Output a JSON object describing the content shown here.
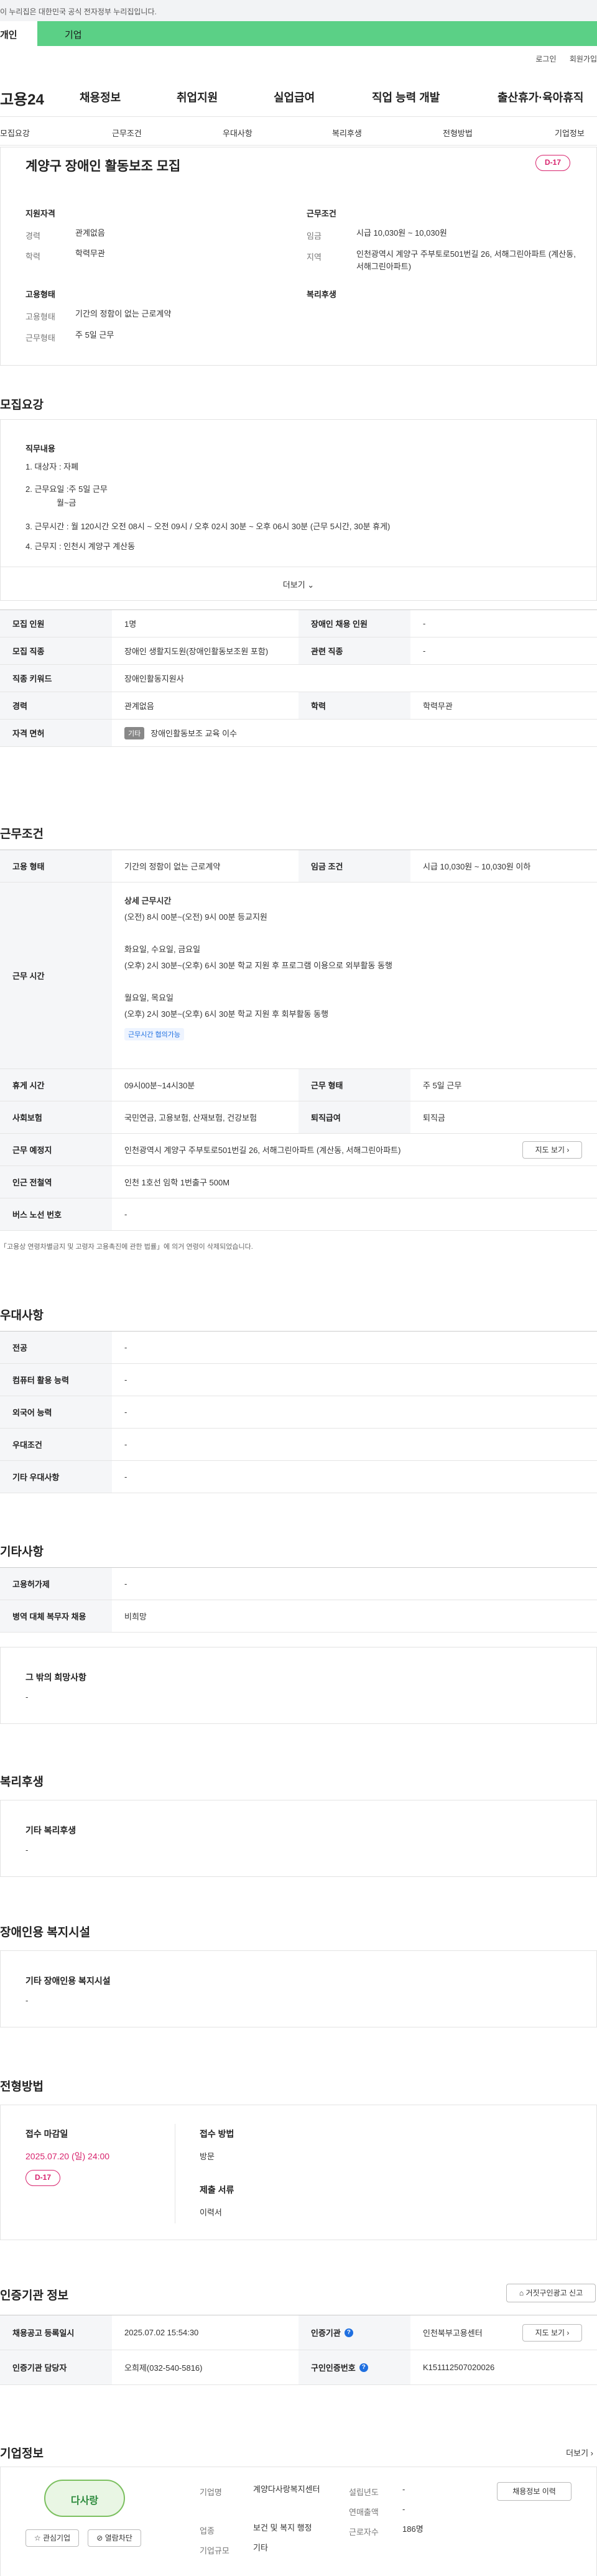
{
  "banner": {
    "text": "이 누리집은 대한민국 공식 전자정부 누리집입니다."
  },
  "tabs": {
    "individual": "개인",
    "business": "기업"
  },
  "top_links": {
    "login": "로그인",
    "signup": "회원가입"
  },
  "gnb": {
    "logo": "고용24",
    "items": [
      "채용정보",
      "취업지원",
      "실업급여",
      "직업 능력 개발",
      "출산휴가·육아휴직"
    ]
  },
  "subnav": [
    "모집요강",
    "근무조건",
    "우대사항",
    "복리후생",
    "전형방법",
    "기업정보"
  ],
  "summary": {
    "title": "계양구 장애인 활동보조 모집",
    "dday": "D-17",
    "qual_title": "지원자격",
    "career_k": "경력",
    "career_v": "관계없음",
    "edu_k": "학력",
    "edu_v": "학력무관",
    "cond_title": "근무조건",
    "wage_k": "임금",
    "wage_v": "시급 10,030원 ~ 10,030원",
    "area_k": "지역",
    "area_v": "인천광역시 계양구 주부토로501번길 26, 서해그린아파트 (계산동, 서해그린아파트)",
    "emp_title": "고용형태",
    "emptype_k": "고용형태",
    "emptype_v": "기간의 정함이 없는 근로계약",
    "worktype_k": "근무형태",
    "worktype_v": "주 5일 근무",
    "welfare_title": "복리후생"
  },
  "recruit": {
    "section_title": "모집요강",
    "duty_title": "직무내용",
    "lines": [
      "1. 대상자 : 자폐",
      "2. 근무요일 :주 5일 근무",
      "월~금",
      "3. 근무시간 : 월 120시간 오전 08시 ~ 오전 09시 / 오후 02시 30분 ~ 오후 06시 30분 (근무 5시간, 30분 휴게)",
      "4. 근무지 : 인천시 계양구 계산동"
    ],
    "more": "더보기",
    "rows": [
      {
        "k1": "모집 인원",
        "v1": "1명",
        "k2": "장애인 채용 인원",
        "v2": "-"
      },
      {
        "k1": "모집 직종",
        "v1": "장애인 생활지도원(장애인활동보조원 포함)",
        "k2": "관련 직종",
        "v2": "-"
      },
      {
        "k1": "직종 키워드",
        "v1": "장애인활동지원사"
      },
      {
        "k1": "경력",
        "v1": "관계없음",
        "k2": "학력",
        "v2": "학력무관"
      },
      {
        "k1": "자격 면허",
        "tag": "기타",
        "v1": "장애인활동보조 교육 이수"
      }
    ]
  },
  "conditions": {
    "section_title": "근무조건",
    "emp_k": "고용 형태",
    "emp_v": "기간의 정함이 없는 근로계약",
    "wage_k": "임금 조건",
    "wage_v": "시급 10,030원 ~ 10,030원 이하",
    "hours_k": "근무 시간",
    "hours_title": "상세 근무시간",
    "hours_lines": [
      "(오전) 8시 00분~(오전) 9시 00분 등교지원",
      "화요일, 수요일, 금요일",
      "(오후) 2시 30분~(오후) 6시 30분 학교 지원 후 프로그램 이용으로 외부활동 동행",
      "월요일, 목요일",
      "(오후) 2시 30분~(오후) 6시 30분 학교 지원 후 회부활동 동행"
    ],
    "hours_tag": "근무시간 협의가능",
    "break_k": "휴게 시간",
    "break_v": "09시00분~14시30분",
    "form_k": "근무 형태",
    "form_v": "주 5일 근무",
    "ins_k": "사회보험",
    "ins_v": "국민연금, 고용보험, 산재보험, 건강보험",
    "ret_k": "퇴직급여",
    "ret_v": "퇴직금",
    "place_k": "근무 예정지",
    "place_v": "인천광역시 계양구 주부토로501번길 26, 서해그린아파트 (계산동, 서해그린아파트)",
    "map_btn": "지도 보기",
    "subway_k": "인근 전철역",
    "subway_v": "인천 1호선 임학 1번출구 500M",
    "bus_k": "버스 노선 번호",
    "bus_v": "-",
    "note": "「고용상 연령차별금지 및 고령자 고용촉진에 관한 법률」에 의거 연령이 삭제되었습니다."
  },
  "prefer": {
    "section_title": "우대사항",
    "rows": [
      {
        "k": "전공",
        "v": "-"
      },
      {
        "k": "컴퓨터 활용 능력",
        "v": "-"
      },
      {
        "k": "외국어 능력",
        "v": "-"
      },
      {
        "k": "우대조건",
        "v": "-"
      },
      {
        "k": "기타 우대사항",
        "v": "-"
      }
    ]
  },
  "other": {
    "section_title": "기타사항",
    "rows": [
      {
        "k": "고용허가제",
        "v": "-"
      },
      {
        "k": "병역 대체 복무자 채용",
        "v": "비희망"
      }
    ],
    "wish_title": "그 밖의 희망사항",
    "wish_v": "-"
  },
  "welfare": {
    "section_title": "복리후생",
    "box_title": "기타 복리후생",
    "box_v": "-"
  },
  "disabled": {
    "section_title": "장애인용 복지시설",
    "box_title": "기타 장애인용 복지시설",
    "box_v": "-"
  },
  "selection": {
    "section_title": "전형방법",
    "deadline_k": "접수 마감일",
    "deadline_v": "2025.07.20 (일) 24:00",
    "dday": "D-17",
    "method_k": "접수 방법",
    "method_v": "방문",
    "docs_k": "제출 서류",
    "docs_v": "이력서"
  },
  "cert": {
    "section_title": "인증기관 정보",
    "report_btn": "거짓구인광고 신고",
    "date_k": "채용공고 등록일시",
    "date_v": "2025.07.02 15:54:30",
    "org_k": "인증기관",
    "org_v": "인천북부고용센터",
    "map_btn": "지도 보기",
    "mgr_k": "인증기관 담당자",
    "mgr_v": "오희제(032-540-5816)",
    "no_k": "구인인증번호",
    "no_v": "K151112507020026"
  },
  "company": {
    "section_title": "기업정보",
    "more": "더보기",
    "name_k": "기업명",
    "name_v": "계양다사랑복지센터",
    "industry_k": "업종",
    "industry_v": "보건 및 복지 행정",
    "size_k": "기업규모",
    "size_v": "기타",
    "founded_k": "설립년도",
    "founded_v": "-",
    "sales_k": "연매출액",
    "sales_v": "-",
    "emps_k": "근로자수",
    "emps_v": "186명",
    "interest_btn": "관심기업",
    "hide_btn": "열람차단",
    "jobs_btn": "채용정보 이력",
    "logo_text": "다사랑"
  }
}
